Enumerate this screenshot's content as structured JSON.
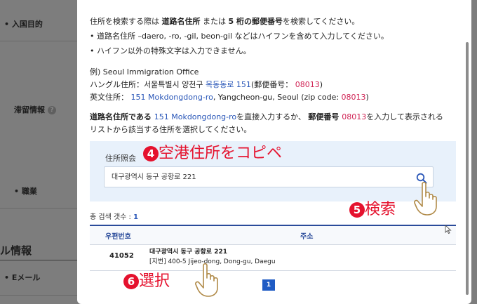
{
  "background": {
    "items": [
      "入国目的",
      "滞留情報",
      "職業",
      "ル情報",
      "Eメール"
    ],
    "help_glyph": "?"
  },
  "modal": {
    "intro": {
      "line1_a": "住所を検索する際は ",
      "line1_b": "道路名住所",
      "line1_c": " または ",
      "line1_d": "5 桁の郵便番号",
      "line1_e": "を検索してください。",
      "line2": "• 道路名住所 –daero, -ro, -gil, beon-gil などはハイフンを含めて入力してください。",
      "line3": "• ハイフン以外の特殊文字は入力できません。"
    },
    "example": {
      "title": "例) Seoul Immigration Office",
      "hangul_label": "ハングル住所：서울특별시 양천구 ",
      "hangul_road": "목동동로 151",
      "hangul_zip_label": "(郵便番号： ",
      "hangul_zip": "08013",
      "hangul_close": ")",
      "en_label": "英文住所： ",
      "en_road": "151 Mokdongdong-ro",
      "en_rest": ", Yangcheon-gu, Seoul (zip code: ",
      "en_zip": "08013",
      "en_close": ")"
    },
    "instruction": {
      "a": "道路名住所である ",
      "b": "151 Mokdongdong-ro",
      "c": "を直接入力するか、 ",
      "d": "郵便番号 ",
      "e": "08013",
      "f": "を入力して表示される",
      "line2": "リストから該当する住所を選択してください。"
    },
    "search": {
      "label": "住所照会",
      "value": "대구광역시 동구 공항로 221"
    },
    "result_count_label": "총 검색 갯수 : ",
    "result_count": "1",
    "table": {
      "headers": [
        "우편번호",
        "주소"
      ],
      "rows": [
        {
          "zip": "41052",
          "address_kr": "대구광역시 동구 공항로 221",
          "address_en": "[지번] 400-5 Jijeo-dong, Dong-gu, Daegu"
        }
      ]
    },
    "pagination": {
      "current": "1"
    }
  },
  "annotations": {
    "step4_num": "4",
    "step4_text": "空港住所をコピペ",
    "step5_num": "5",
    "step5_text": "検索",
    "step6_num": "6",
    "step6_text": "選択"
  },
  "colors": {
    "accent": "#2a57b8",
    "highlight": "#d02455",
    "annotation": "#e5122e",
    "search_panel": "#e8f1fb"
  }
}
